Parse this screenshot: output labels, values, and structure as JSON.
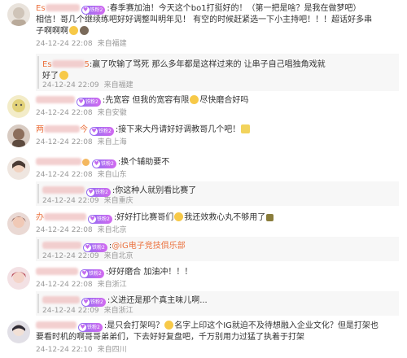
{
  "comments": [
    {
      "user_prefix": "Es",
      "user_suffix": "",
      "text": ":春季赛加油！今天这个bo1打挺好的！（第一把是啥？是我在做梦吧）相信！哥几个继续练吧好好调整叫明年见！ 有空的时候赶紧选一下小主持吧！！！超话好多串子啊啊啊",
      "line1": ":春季赛加油！今天这个bo1打挺好的！（第一把是啥？是我在做梦吧）",
      "line2": "相信！哥几个继续练吧好好调整叫明年见！ 有空的时候赶紧选一下小主持吧！！！超话好多串",
      "line3": "子啊啊啊",
      "time": "24-12-24 22:08",
      "location": "来自福建",
      "reply": {
        "user_prefix": "Es",
        "user_suffix": "5",
        "line1": ":赢了吹输了骂死 那么多年都是这样过来的 让串子自己唱独角戏就",
        "line2": "好了",
        "time": "24-12-24 22:09",
        "location": "来自福建"
      }
    },
    {
      "user_prefix": "",
      "user_suffix": "",
      "text": ":先宽容 但我的宽容有限",
      "text_after": "尽快磨合好吗",
      "time": "24-12-24 22:08",
      "location": "来自安徽"
    },
    {
      "user_prefix": "两",
      "user_suffix": "今",
      "text": ":接下来大丹请好好调教哥几个吧！",
      "time": "24-12-24 22:08",
      "location": "来自上海"
    },
    {
      "user_prefix": "",
      "user_suffix": "",
      "text": ":换个辅助要不",
      "time": "24-12-24 22:08",
      "location": "来自山东",
      "reply": {
        "user_prefix": "",
        "user_suffix": "",
        "line1": ":你这种人就别看比赛了",
        "time": "24-12-24 22:09",
        "location": "来自重庆"
      }
    },
    {
      "user_prefix": "办",
      "user_suffix": "",
      "text": ":好好打比赛哥们",
      "text_after": "我还效救心丸不够用了",
      "time": "24-12-24 22:08",
      "location": "来自北京",
      "reply": {
        "user_prefix": "",
        "user_suffix": "",
        "line1_prefix": ":",
        "link": "@iG电子竞技俱乐部",
        "time": "24-12-24 22:09",
        "location": "来自北京"
      }
    },
    {
      "user_prefix": "",
      "user_suffix": "",
      "text": ":好好磨合 加油冲！！！",
      "time": "24-12-24 22:08",
      "location": "来自浙江",
      "reply": {
        "user_prefix": "",
        "user_suffix": "",
        "line1": ":义进还是那个真主味儿啊...",
        "time": "24-12-24 22:09",
        "location": "来自浙江"
      }
    },
    {
      "user_prefix": "",
      "user_suffix": "",
      "line1": ":是只会打架吗？",
      "line1_after": "名字上印这个IG就迫不及待想融入企业文化？但是打架也",
      "line2": "要看时机的啊哥哥弟弟们，下去好好复盘吧，千万别用力过猛了执着于打架",
      "time": "24-12-24 22:10",
      "location": "来自四川"
    }
  ],
  "fan_badge": "铁粉2",
  "colors": {
    "username": "#eb7340",
    "meta": "#999999",
    "reply_bg": "#f7f7f7",
    "badge_start": "#8f6cf2",
    "badge_end": "#d26bf0"
  },
  "icons": [
    "avatar",
    "fan-badge-heart-icon",
    "emoji-icon"
  ]
}
